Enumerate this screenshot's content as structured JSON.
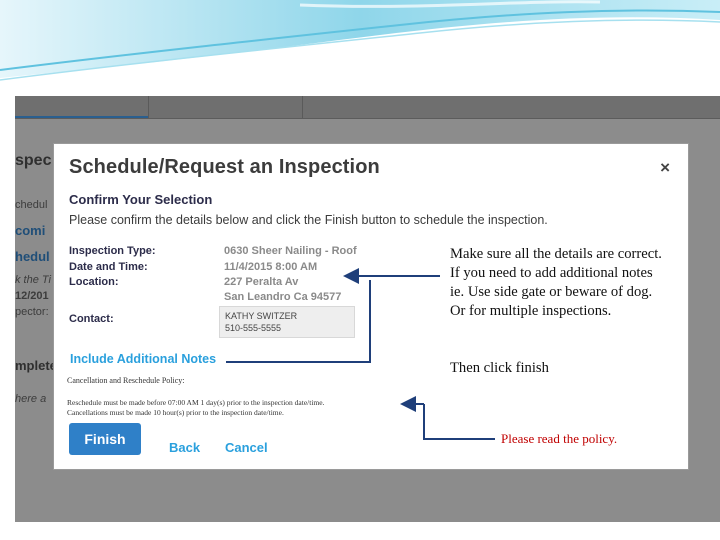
{
  "background": {
    "heading": "spec",
    "line1": "chedul",
    "line2": "comi",
    "line3": "hedul",
    "line4": "k the Ti",
    "line5": "12/201",
    "line6": "pector:",
    "line7": "mplete",
    "line8": "here a"
  },
  "modal": {
    "title": "Schedule/Request an Inspection",
    "close": "×",
    "confirm_heading": "Confirm Your Selection",
    "confirm_sub": "Please confirm the details below and click the Finish button to schedule the inspection.",
    "fields": [
      {
        "label": "Inspection Type:",
        "value": "0630 Sheer Nailing - Roof"
      },
      {
        "label": "Date and Time:",
        "value": "11/4/2015 8:00 AM"
      },
      {
        "label": "Location:",
        "value": "227 Peralta Av"
      }
    ],
    "location_line2": "San Leandro Ca 94577",
    "contact_label": "Contact:",
    "contact_name": "KATHY SWITZER",
    "contact_phone": "510-555-5555",
    "include_notes": "Include Additional Notes",
    "policy_heading": "Cancellation and Reschedule Policy:",
    "policy_line1": "Reschedule must be made before 07:00 AM 1 day(s) prior to the inspection date/time.",
    "policy_line2": "Cancellations must be made 10 hour(s) prior to the inspection date/time.",
    "finish": "Finish",
    "back": "Back",
    "cancel": "Cancel"
  },
  "annotations": {
    "details_note": "Make sure all the details are correct. If you need to add additional notes ie. Use side gate or beware of dog.  Or for multiple inspections.",
    "then_click": "Then click finish",
    "policy_note": "Please read the policy."
  },
  "colors": {
    "accent_blue": "#2f80c8",
    "link_blue": "#2aa0dd",
    "arrow_blue": "#1f3f7a",
    "note_red": "#c00000"
  }
}
